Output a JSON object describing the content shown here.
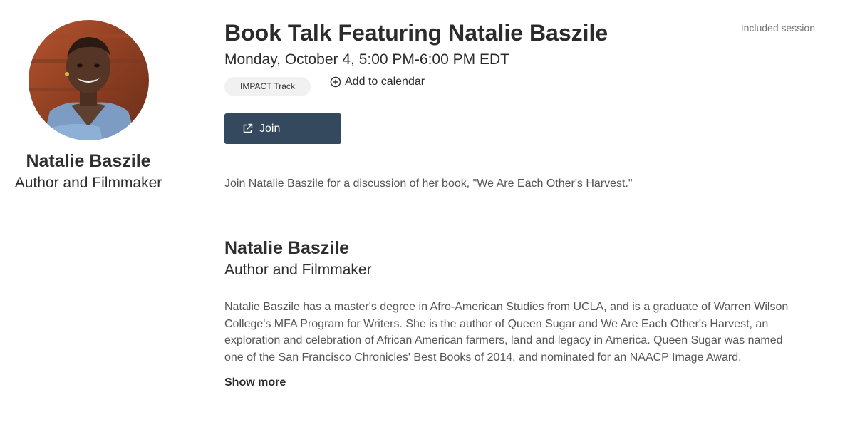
{
  "speaker": {
    "name": "Natalie Baszile",
    "role": "Author and Filmmaker"
  },
  "session": {
    "title": "Book Talk Featuring Natalie Baszile",
    "datetime": "Monday, October 4, 5:00 PM-6:00 PM EDT",
    "included_label": "Included session",
    "track_badge": "IMPACT Track",
    "add_to_calendar": "Add to calendar",
    "join_label": "Join",
    "description": "Join Natalie Baszile for a discussion of her book, \"We Are Each Other's Harvest.\""
  },
  "bio": {
    "name": "Natalie Baszile",
    "role": "Author and Filmmaker",
    "text": "Natalie Baszile has a master's degree in Afro-American Studies from UCLA, and is a graduate of Warren Wilson College's MFA Program for Writers. She is the author of Queen Sugar and We Are Each Other's Harvest, an exploration and celebration of African American farmers, land and legacy in America. Queen Sugar was named one of the San Francisco Chronicles' Best Books of 2014, and nominated for an NAACP Image Award.",
    "show_more": "Show more"
  },
  "icons": {
    "calendar": "plus-circle-icon",
    "join": "external-link-icon"
  },
  "colors": {
    "join_button": "#34495e",
    "badge_bg": "#f1f1f1",
    "muted_text": "#555555"
  }
}
